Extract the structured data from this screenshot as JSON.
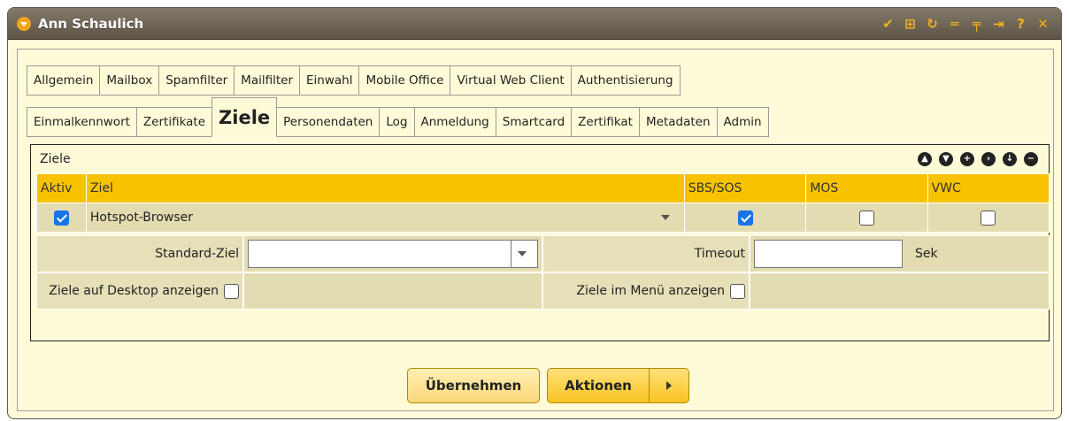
{
  "window": {
    "title": "Ann Schaulich",
    "title_icons": [
      "check-icon",
      "grid-icon",
      "refresh-icon",
      "minimize-icon",
      "pin-icon",
      "unpin-icon",
      "help-icon",
      "close-icon"
    ]
  },
  "tabs_row1": [
    "Allgemein",
    "Mailbox",
    "Spamfilter",
    "Mailfilter",
    "Einwahl",
    "Mobile Office",
    "Virtual Web Client",
    "Authentisierung"
  ],
  "tabs_row2": [
    "Einmalkennwort",
    "Zertifikate",
    "Ziele",
    "Personendaten",
    "Log",
    "Anmeldung",
    "Smartcard",
    "Zertifikat",
    "Metadaten",
    "Admin"
  ],
  "active_tab": "Ziele",
  "panel": {
    "label": "Ziele",
    "nav_icons": [
      "move-up-icon",
      "move-down-icon",
      "add-icon",
      "next-icon",
      "download-icon",
      "remove-icon"
    ]
  },
  "table": {
    "headers": [
      "Aktiv",
      "Ziel",
      "SBS/SOS",
      "MOS",
      "VWC"
    ],
    "rows": [
      {
        "aktiv": true,
        "ziel": "Hotspot-Browser",
        "sbs_sos": true,
        "mos": false,
        "vwc": false
      }
    ]
  },
  "form": {
    "standard_ziel_label": "Standard-Ziel",
    "standard_ziel_value": "",
    "timeout_label": "Timeout",
    "timeout_value": "",
    "timeout_unit": "Sek",
    "desktop_label": "Ziele auf Desktop anzeigen",
    "desktop_checked": false,
    "menu_label": "Ziele im Menü anzeigen",
    "menu_checked": false
  },
  "buttons": {
    "apply": "Übernehmen",
    "actions": "Aktionen"
  },
  "colors": {
    "titlebar": "#6e6555",
    "background": "#fffbd8",
    "header": "#f7c300",
    "row": "#e2dcb0",
    "checkbox_on": "#1a73e8"
  }
}
